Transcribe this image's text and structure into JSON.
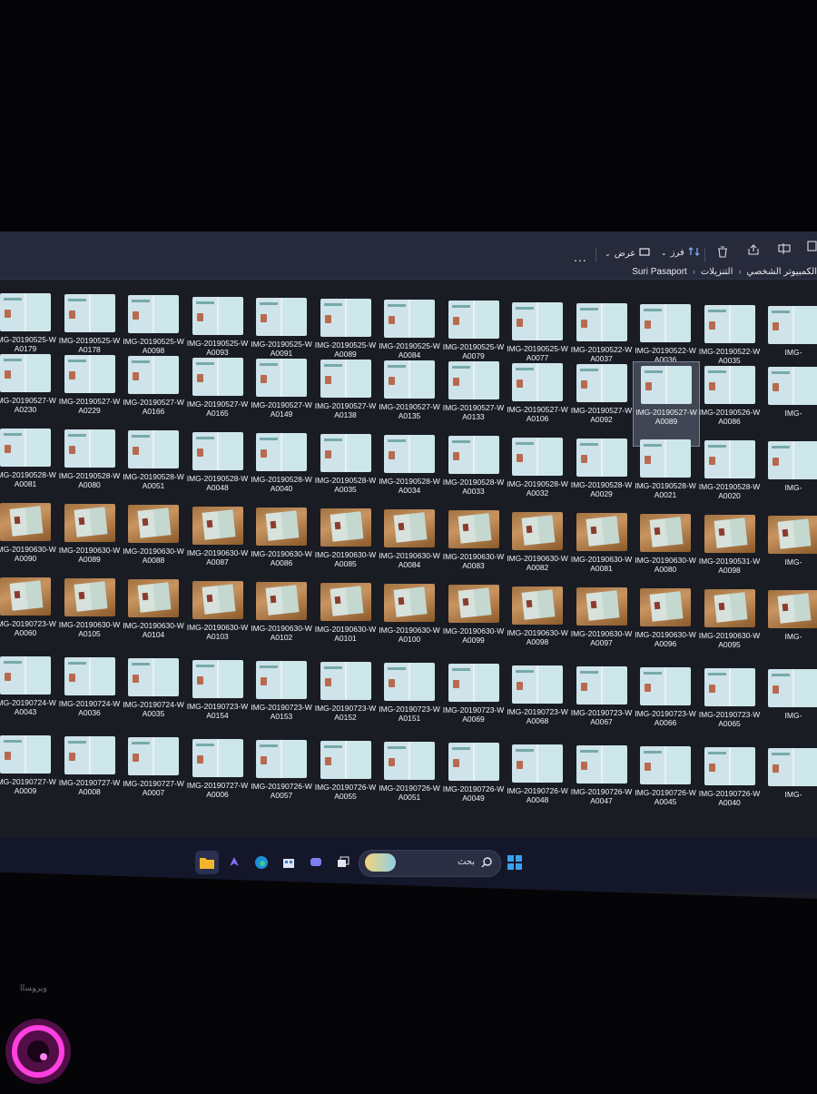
{
  "toolbar": {
    "more_label": "...",
    "view_label": "عرض",
    "sort_label": "فرز"
  },
  "breadcrumb": {
    "items": [
      "Suri Pasaport",
      "التنزيلات",
      "الكمبيوتر الشخصي"
    ]
  },
  "files": [
    [
      "IMG-20190525-W\nA0179",
      "IMG-20190525-W\nA0178",
      "IMG-20190525-W\nA0098",
      "IMG-20190525-W\nA0093",
      "IMG-20190525-W\nA0091",
      "IMG-20190525-W\nA0089",
      "IMG-20190525-W\nA0084",
      "IMG-20190525-W\nA0079",
      "IMG-20190525-W\nA0077",
      "IMG-20190522-W\nA0037",
      "IMG-20190522-W\nA0036",
      "IMG-20190522-W\nA0035",
      "IMG-"
    ],
    [
      "IMG-20190527-W\nA0230",
      "IMG-20190527-W\nA0229",
      "IMG-20190527-W\nA0166",
      "IMG-20190527-W\nA0165",
      "IMG-20190527-W\nA0149",
      "IMG-20190527-W\nA0138",
      "IMG-20190527-W\nA0135",
      "IMG-20190527-W\nA0133",
      "IMG-20190527-W\nA0106",
      "IMG-20190527-W\nA0092",
      "IMG-20190527-W\nA0089",
      "IMG-20190526-W\nA0086",
      "IMG-"
    ],
    [
      "IMG-20190528-W\nA0081",
      "IMG-20190528-W\nA0080",
      "IMG-20190528-W\nA0051",
      "IMG-20190528-W\nA0048",
      "IMG-20190528-W\nA0040",
      "IMG-20190528-W\nA0035",
      "IMG-20190528-W\nA0034",
      "IMG-20190528-W\nA0033",
      "IMG-20190528-W\nA0032",
      "IMG-20190528-W\nA0029",
      "IMG-20190528-W\nA0021",
      "IMG-20190528-W\nA0020",
      "IMG-"
    ],
    [
      "IMG-20190630-W\nA0090",
      "IMG-20190630-W\nA0089",
      "IMG-20190630-W\nA0088",
      "IMG-20190630-W\nA0087",
      "IMG-20190630-W\nA0086",
      "IMG-20190630-W\nA0085",
      "IMG-20190630-W\nA0084",
      "IMG-20190630-W\nA0083",
      "IMG-20190630-W\nA0082",
      "IMG-20190630-W\nA0081",
      "IMG-20190630-W\nA0080",
      "IMG-20190531-W\nA0098",
      "IMG-"
    ],
    [
      "IMG-20190723-W\nA0060",
      "IMG-20190630-W\nA0105",
      "IMG-20190630-W\nA0104",
      "IMG-20190630-W\nA0103",
      "IMG-20190630-W\nA0102",
      "IMG-20190630-W\nA0101",
      "IMG-20190630-W\nA0100",
      "IMG-20190630-W\nA0099",
      "IMG-20190630-W\nA0098",
      "IMG-20190630-W\nA0097",
      "IMG-20190630-W\nA0096",
      "IMG-20190630-W\nA0095",
      "IMG-"
    ],
    [
      "IMG-20190724-W\nA0043",
      "IMG-20190724-W\nA0036",
      "IMG-20190724-W\nA0035",
      "IMG-20190723-W\nA0154",
      "IMG-20190723-W\nA0153",
      "IMG-20190723-W\nA0152",
      "IMG-20190723-W\nA0151",
      "IMG-20190723-W\nA0069",
      "IMG-20190723-W\nA0068",
      "IMG-20190723-W\nA0067",
      "IMG-20190723-W\nA0066",
      "IMG-20190723-W\nA0065",
      "IMG-"
    ],
    [
      "IMG-20190727-W\nA0009",
      "IMG-20190727-W\nA0008",
      "IMG-20190727-W\nA0007",
      "IMG-20190727-W\nA0006",
      "IMG-20190726-W\nA0057",
      "IMG-20190726-W\nA0055",
      "IMG-20190726-W\nA0051",
      "IMG-20190726-W\nA0049",
      "IMG-20190726-W\nA0048",
      "IMG-20190726-W\nA0047",
      "IMG-20190726-W\nA0045",
      "IMG-20190726-W\nA0040",
      "IMG-"
    ]
  ],
  "photo_rows": [
    3,
    4
  ],
  "selected": {
    "row": 1,
    "col": 10
  },
  "taskbar": {
    "search_placeholder": "بحث",
    "icons": [
      "file-explorer-icon",
      "copilot-icon",
      "edge-icon",
      "store-icon",
      "chat-icon",
      "task-view-icon"
    ]
  },
  "overlay": {
    "watermark_text": "ﻭﻳﺮﻮﺴﻟﺍ"
  },
  "colors": {
    "window_bg": "#1a1c24",
    "toolbar_bg": "#262a3a",
    "taskbar_bg": "#14172a",
    "accent": "#2f7bd8",
    "badge": "#e020c0"
  }
}
